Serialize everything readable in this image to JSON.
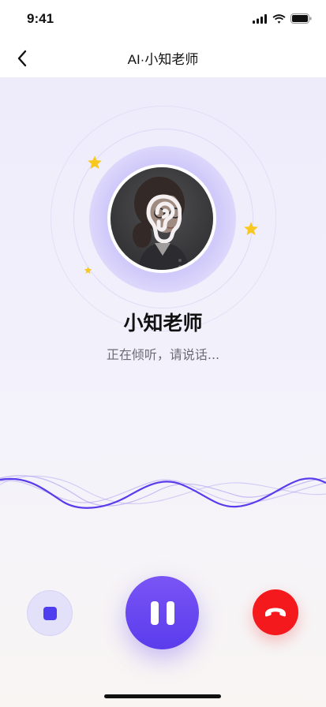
{
  "status_bar": {
    "time": "9:41",
    "icons": [
      "signal-icon",
      "wifi-icon",
      "battery-icon"
    ]
  },
  "nav": {
    "title": "AI·小知老师",
    "back_icon": "chevron-left-icon"
  },
  "assistant": {
    "name": "小知老师",
    "status_text": "正在倾听，请说话...",
    "avatar_overlay_icon": "ear-icon"
  },
  "controls": {
    "stop_icon": "stop-icon",
    "pause_icon": "pause-icon",
    "hangup_icon": "hang-up-icon"
  },
  "colors": {
    "accent": "#5a3cec",
    "hangup": "#f3191d",
    "star": "#f7c820",
    "wave": "#6a4ee8"
  }
}
